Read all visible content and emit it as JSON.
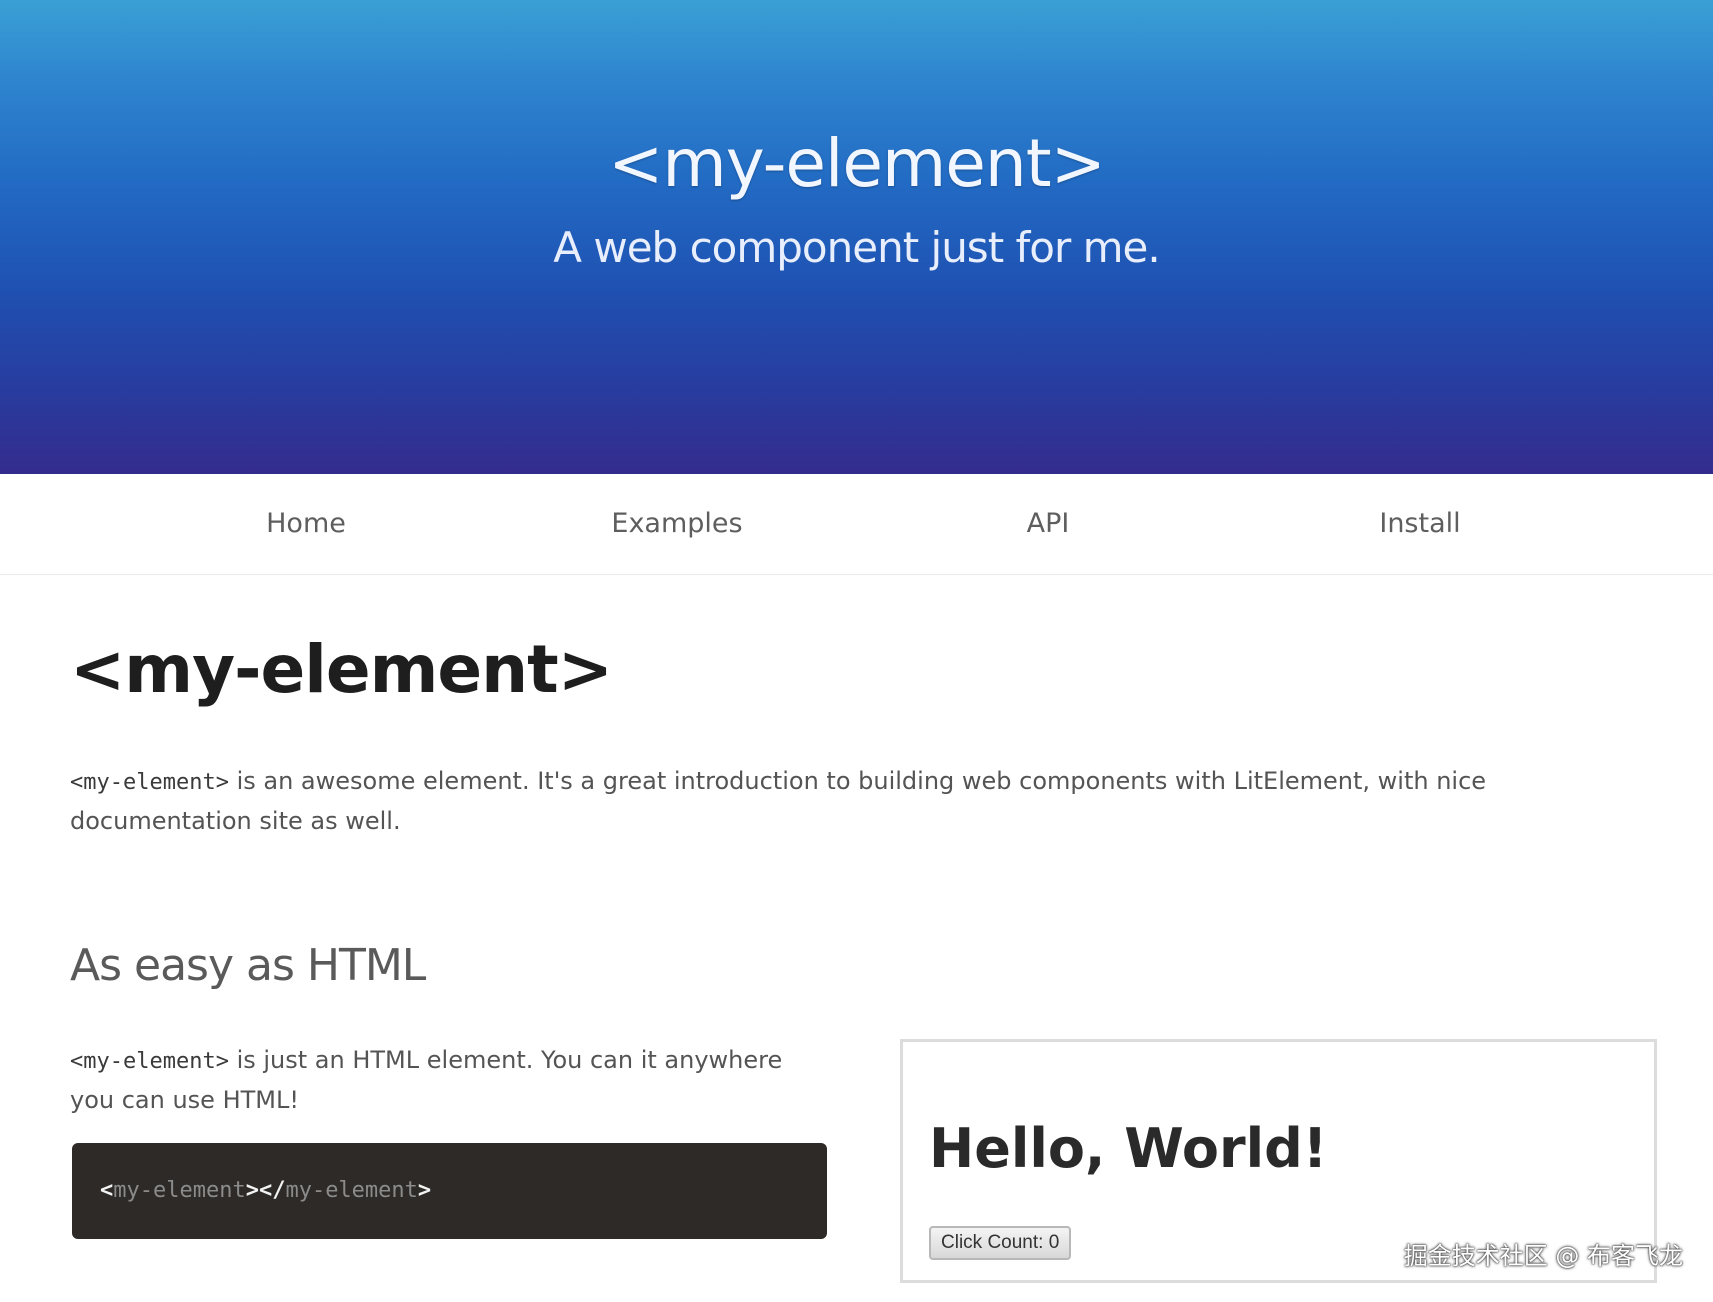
{
  "hero": {
    "title": "<my-element>",
    "subtitle": "A web component just for me."
  },
  "nav": {
    "items": [
      {
        "label": "Home"
      },
      {
        "label": "Examples"
      },
      {
        "label": "API"
      },
      {
        "label": "Install"
      }
    ]
  },
  "main": {
    "title": "<my-element>",
    "intro": {
      "code": "<my-element>",
      "text": " is an awesome element. It's a great introduction to building web components with LitElement, with nice documentation site as well."
    },
    "section": {
      "heading": "As easy as HTML",
      "text_code": "<my-element>",
      "text": " is just an HTML element. You can it anywhere you can use HTML!"
    },
    "code_block": {
      "open_lt": "<",
      "open_name": "my-element",
      "open_gt": ">",
      "close_lt": "</",
      "close_name": "my-element",
      "close_gt": ">"
    },
    "demo": {
      "heading": "Hello, World!",
      "button_label": "Click Count: 0"
    }
  },
  "watermark": "掘金技术社区 @ 布客飞龙",
  "colors": {
    "hero_top": "#3aa0d4",
    "hero_bottom": "#342c8d",
    "code_bg": "#2d2a27"
  }
}
